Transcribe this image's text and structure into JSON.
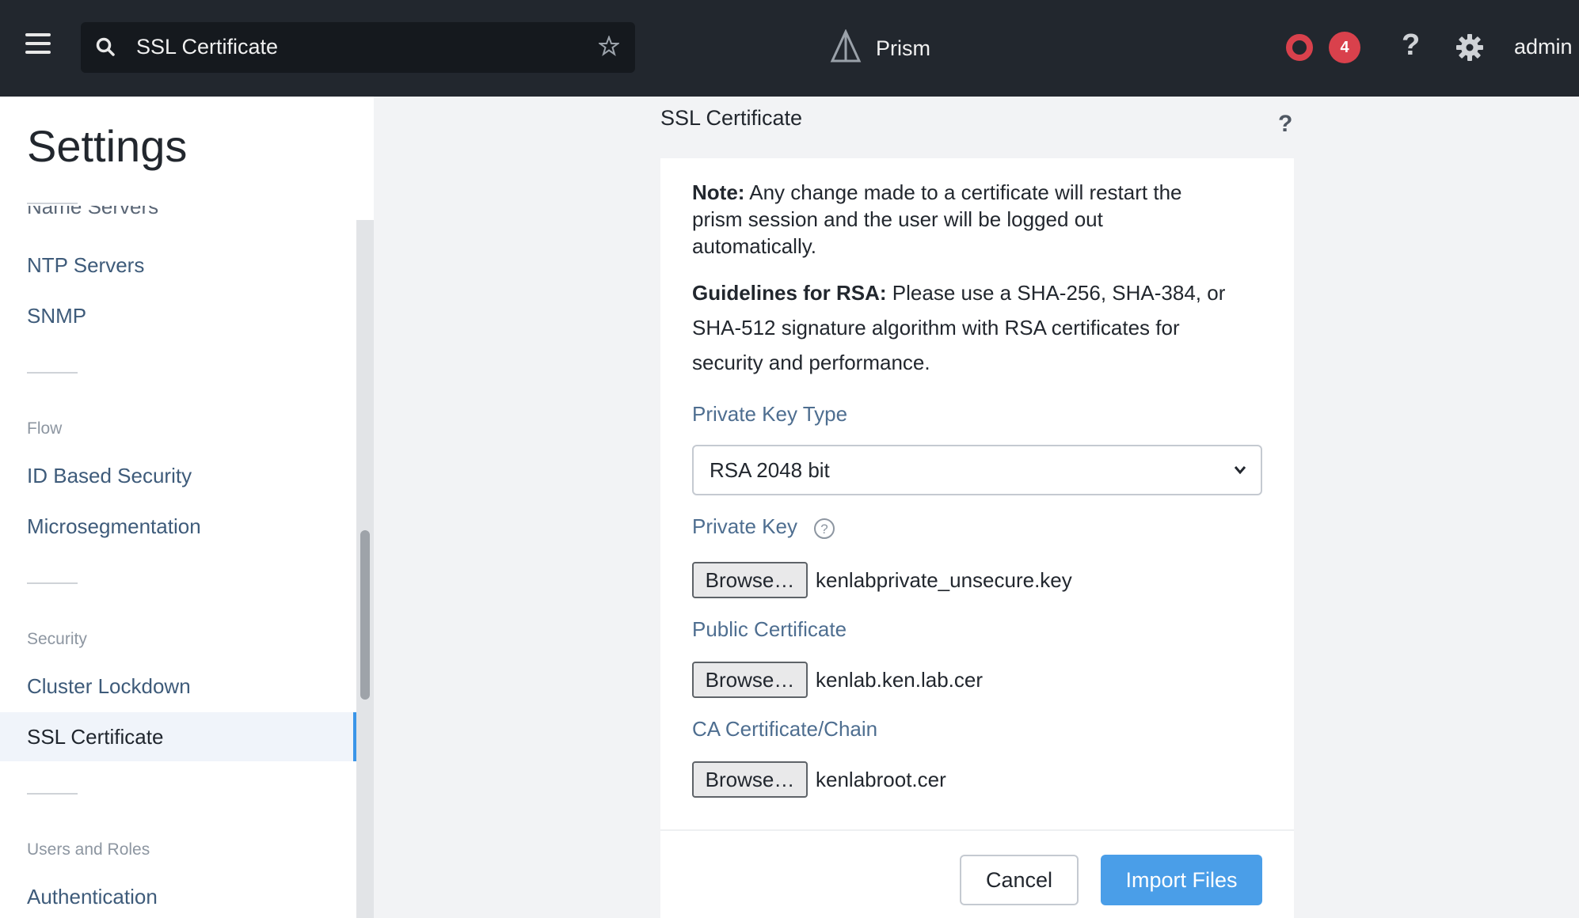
{
  "topbar": {
    "search_value": "SSL Certificate",
    "brand": "Prism",
    "alert_count": "4",
    "help_label": "?",
    "user": "admin"
  },
  "sidebar": {
    "title": "Settings",
    "partial_item": "Name Servers",
    "items_network": [
      "NTP Servers",
      "SNMP"
    ],
    "section_flow": "Flow",
    "items_flow": [
      "ID Based Security",
      "Microsegmentation"
    ],
    "section_security": "Security",
    "items_security": [
      "Cluster Lockdown",
      "SSL Certificate"
    ],
    "active_item": "SSL Certificate",
    "section_users": "Users and Roles",
    "items_users": [
      "Authentication"
    ]
  },
  "panel": {
    "title": "SSL Certificate",
    "help": "?",
    "note_label": "Note:",
    "note_text": " Any change made to a certificate will restart the prism session and the user will be logged out automatically.",
    "guide_label": "Guidelines for RSA:",
    "guide_text": " Please use a SHA-256, SHA-384, or SHA-512 signature algorithm with RSA certificates for security and performance.",
    "key_type_label": "Private Key Type",
    "key_type_value": "RSA 2048 bit",
    "private_key_label": "Private Key",
    "private_key_file": "kenlabprivate_unsecure.key",
    "public_cert_label": "Public Certificate",
    "public_cert_file": "kenlab.ken.lab.cer",
    "ca_label": "CA Certificate/Chain",
    "ca_file": "kenlabroot.cer",
    "browse_label": "Browse…",
    "cancel_label": "Cancel",
    "import_label": "Import Files"
  },
  "colors": {
    "topbar": "#22272e",
    "accent": "#4a9ee8",
    "badge": "#d9414c",
    "active_indicator": "#3a95e8"
  }
}
